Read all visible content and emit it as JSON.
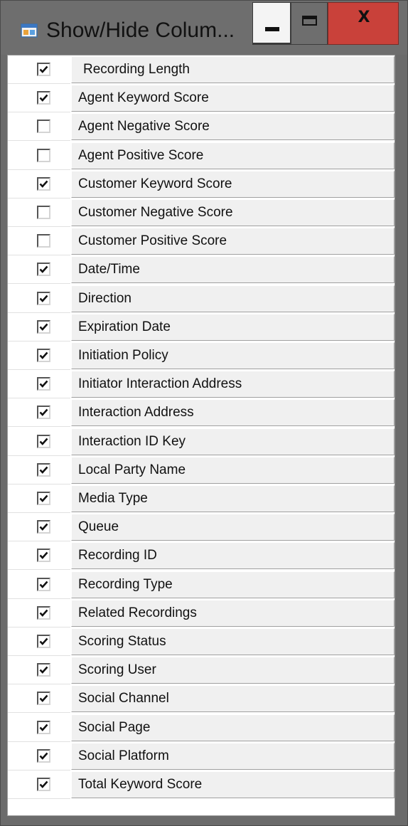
{
  "window": {
    "title": "Show/Hide Colum...",
    "icon": "app-window-icon",
    "controls": {
      "minimize_icon": "minimize-icon",
      "maximize_icon": "maximize-icon",
      "close_label": "X",
      "close_color": "#c9413a"
    }
  },
  "columns": [
    {
      "label": "Recording Length",
      "checked": true
    },
    {
      "label": "Agent Keyword Score",
      "checked": true
    },
    {
      "label": "Agent Negative Score",
      "checked": false
    },
    {
      "label": "Agent Positive Score",
      "checked": false
    },
    {
      "label": "Customer Keyword Score",
      "checked": true
    },
    {
      "label": "Customer Negative Score",
      "checked": false
    },
    {
      "label": "Customer Positive Score",
      "checked": false
    },
    {
      "label": "Date/Time",
      "checked": true
    },
    {
      "label": "Direction",
      "checked": true
    },
    {
      "label": "Expiration Date",
      "checked": true
    },
    {
      "label": "Initiation Policy",
      "checked": true
    },
    {
      "label": "Initiator Interaction Address",
      "checked": true
    },
    {
      "label": "Interaction Address",
      "checked": true
    },
    {
      "label": "Interaction ID Key",
      "checked": true
    },
    {
      "label": "Local Party Name",
      "checked": true
    },
    {
      "label": "Media Type",
      "checked": true
    },
    {
      "label": "Queue",
      "checked": true
    },
    {
      "label": "Recording ID",
      "checked": true
    },
    {
      "label": "Recording Type",
      "checked": true
    },
    {
      "label": "Related Recordings",
      "checked": true
    },
    {
      "label": "Scoring Status",
      "checked": true
    },
    {
      "label": "Scoring User",
      "checked": true
    },
    {
      "label": "Social Channel",
      "checked": true
    },
    {
      "label": "Social Page",
      "checked": true
    },
    {
      "label": "Social Platform",
      "checked": true
    },
    {
      "label": "Total Keyword Score",
      "checked": true
    }
  ]
}
